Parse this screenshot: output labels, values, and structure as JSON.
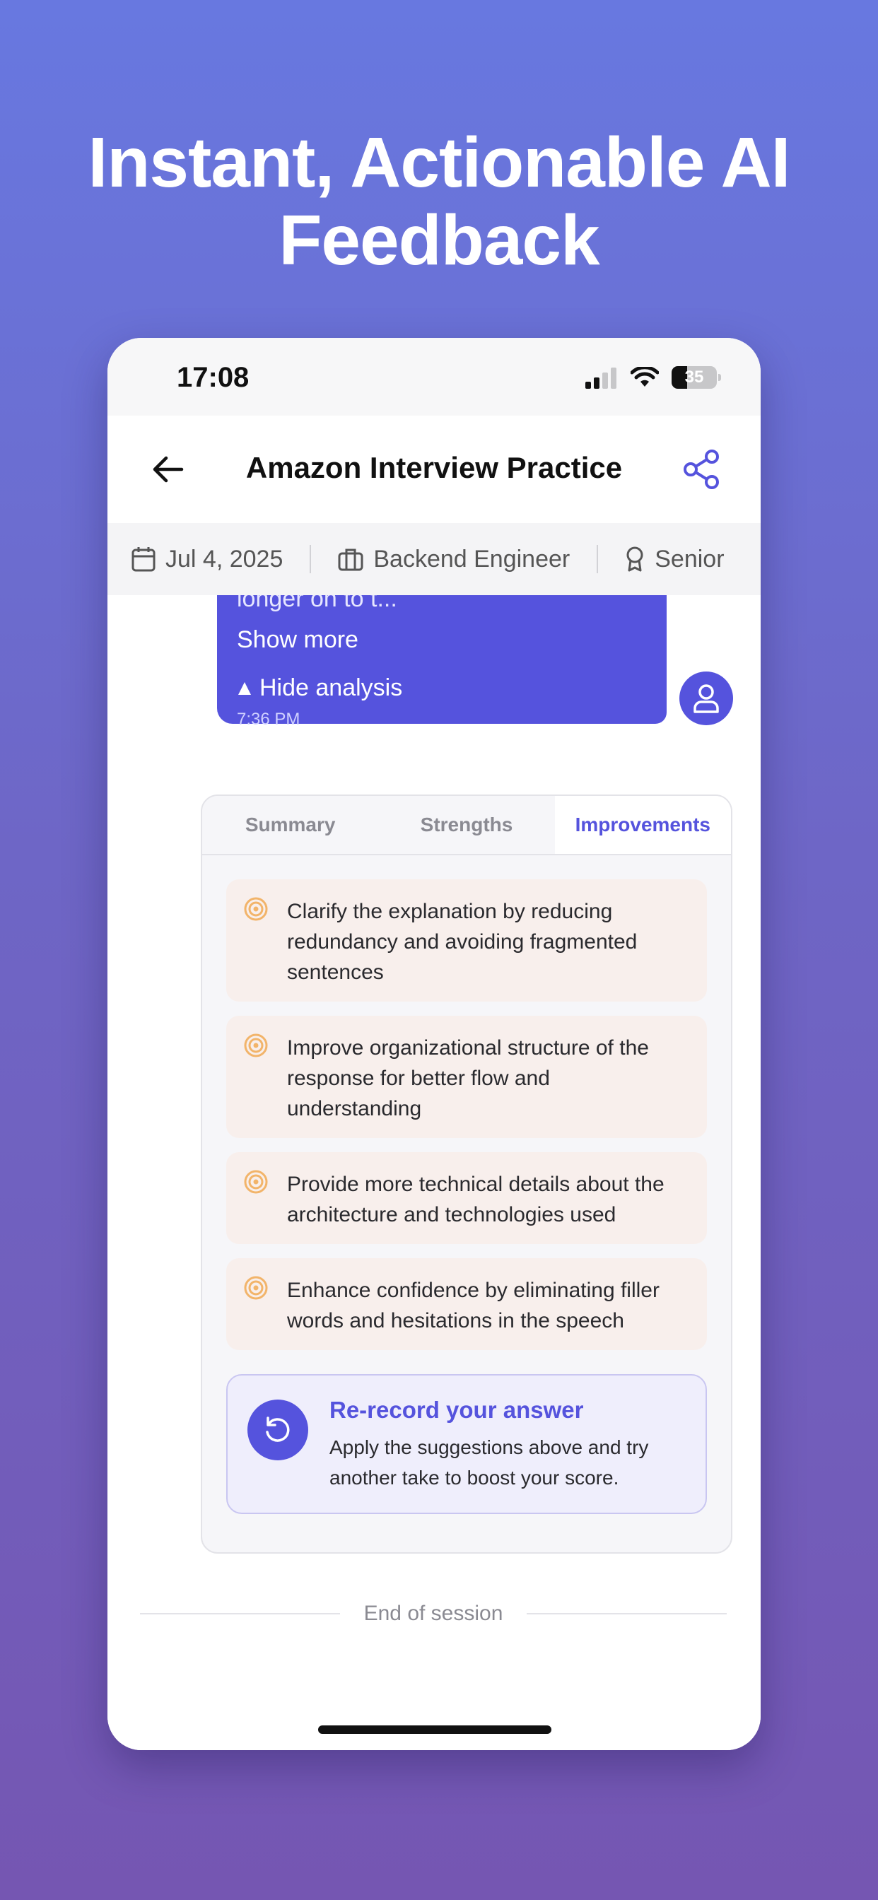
{
  "headline": {
    "line1": "Instant, Actionable AI",
    "line2": "Feedback"
  },
  "status_bar": {
    "time": "17:08",
    "battery": "35"
  },
  "nav": {
    "title": "Amazon Interview Practice"
  },
  "meta": {
    "date": "Jul 4, 2025",
    "role": "Backend Engineer",
    "level": "Senior"
  },
  "message": {
    "truncated_text": "longer on to t...",
    "show_more": "Show more",
    "hide_analysis": "Hide analysis",
    "time": "7:36 PM"
  },
  "analysis": {
    "tabs": [
      {
        "label": "Summary",
        "active": false
      },
      {
        "label": "Strengths",
        "active": false
      },
      {
        "label": "Improvements",
        "active": true
      }
    ],
    "improvements": [
      "Clarify the explanation by reducing redundancy and avoiding fragmented sentences",
      "Improve organizational structure of the response for better flow and understanding",
      "Provide more technical details about the architecture and technologies used",
      "Enhance confidence by eliminating filler words and hesitations in the speech"
    ],
    "rerecord": {
      "title": "Re-record your answer",
      "text": "Apply the suggestions above and try another take to boost your score."
    }
  },
  "footer": {
    "end_text": "End of session"
  },
  "colors": {
    "accent": "#5553dd",
    "improvement_bg": "#f8efec",
    "improvement_icon": "#f2b46a"
  }
}
